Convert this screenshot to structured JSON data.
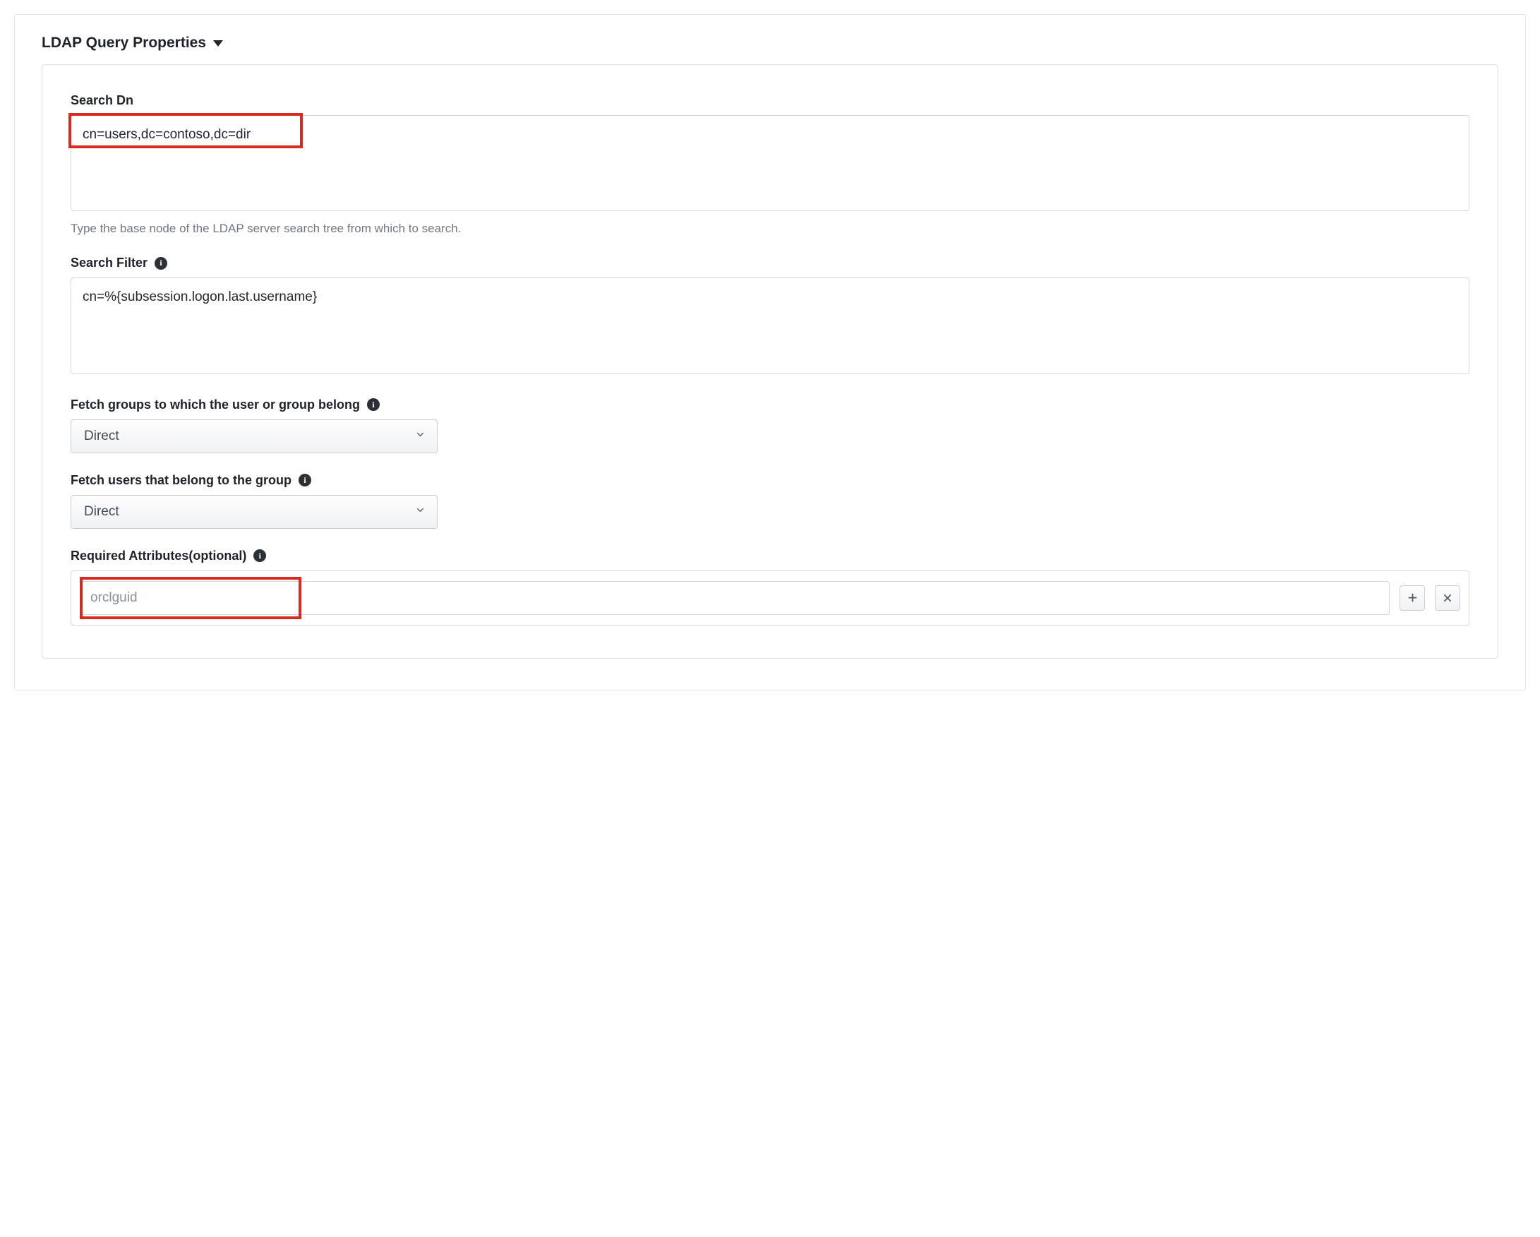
{
  "section": {
    "title": "LDAP Query Properties"
  },
  "searchDn": {
    "label": "Search Dn",
    "value": "cn=users,dc=contoso,dc=dir",
    "help": "Type the base node of the LDAP server search tree from which to search."
  },
  "searchFilter": {
    "label": "Search Filter",
    "value": "cn=%{subsession.logon.last.username}"
  },
  "fetchGroups": {
    "label": "Fetch groups to which the user or group belong",
    "value": "Direct"
  },
  "fetchUsers": {
    "label": "Fetch users that belong to the group",
    "value": "Direct"
  },
  "requiredAttrs": {
    "label": "Required Attributes(optional)",
    "placeholder": "orclguid"
  }
}
